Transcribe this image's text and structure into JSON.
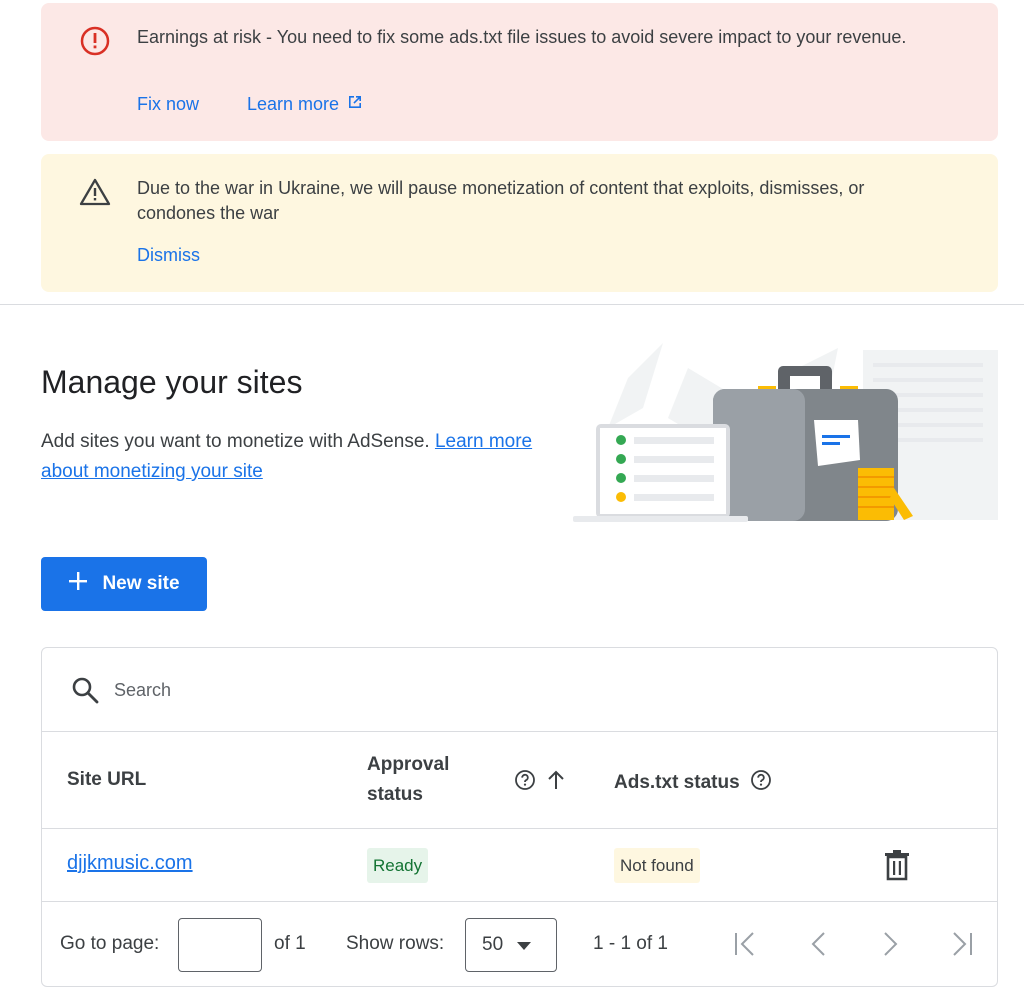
{
  "alerts": {
    "error": {
      "icon": "error-icon",
      "message": "Earnings at risk - You need to fix some ads.txt file issues to avoid severe impact to your revenue.",
      "fix_now": "Fix now",
      "learn_more": "Learn more",
      "color": "#fce8e6"
    },
    "warning": {
      "icon": "warning-icon",
      "message": "Due to the war in Ukraine, we will pause monetization of content that exploits, dismisses, or condones the war",
      "dismiss": "Dismiss",
      "color": "#fef7e0"
    }
  },
  "header": {
    "title": "Manage your sites",
    "description": "Add sites you want to monetize with AdSense.",
    "link": "Learn more about monetizing your site"
  },
  "new_site_button": {
    "icon": "plus-icon",
    "label": "New site",
    "color": "#1a73e8"
  },
  "table": {
    "search_placeholder": "Search",
    "columns": {
      "site_url": "Site URL",
      "approval_status": "Approval status",
      "ads_txt_status": "Ads.txt status"
    },
    "rows": [
      {
        "site": "djjkmusic.com",
        "approval": "Ready",
        "ads_txt": "Not found"
      }
    ]
  },
  "pagination": {
    "go_to_page": "Go to page:",
    "page_value": "",
    "of_pages": "of 1",
    "show_rows": "Show rows:",
    "rows_value": "50",
    "range": "1 - 1 of 1"
  }
}
